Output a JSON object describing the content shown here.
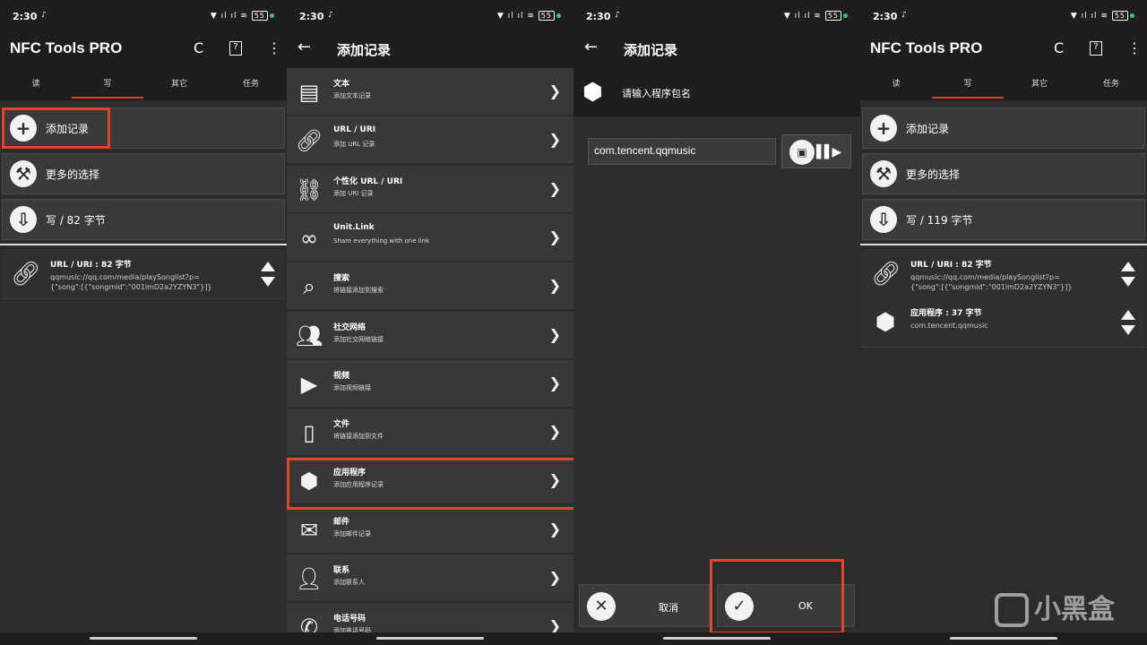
{
  "status": {
    "time": "2:30",
    "battery": "55"
  },
  "app": {
    "title": "NFC Tools PRO",
    "tabs": [
      "读",
      "写",
      "其它",
      "任务"
    ]
  },
  "panel1": {
    "buttons": [
      "添加记录",
      "更多的选择",
      "写 / 82 字节"
    ],
    "record": {
      "title": "URL / URI : 82 字节",
      "desc": "qqmusic://qq.com/media/playSonglist?p={\"song\":[{\"songmid\":\"001lmD2a2YZYN3\"}]}"
    }
  },
  "panel2": {
    "title": "添加记录",
    "items": [
      {
        "title": "文本",
        "desc": "添加文本记录",
        "icon": "document-icon"
      },
      {
        "title": "URL / URI",
        "desc": "添加 URL 记录",
        "icon": "link-icon"
      },
      {
        "title": "个性化 URL / URI",
        "desc": "添加 URI 记录",
        "icon": "custom-link-icon"
      },
      {
        "title": "Unit.Link",
        "desc": "Share everything with one link",
        "icon": "unit-link-icon"
      },
      {
        "title": "搜索",
        "desc": "将链接添加到搜索",
        "icon": "search-icon"
      },
      {
        "title": "社交网络",
        "desc": "添加社交网络链接",
        "icon": "people-icon"
      },
      {
        "title": "视频",
        "desc": "添加视频链接",
        "icon": "video-icon"
      },
      {
        "title": "文件",
        "desc": "将链接添加到文件",
        "icon": "file-icon"
      },
      {
        "title": "应用程序",
        "desc": "添加应用程序记录",
        "icon": "cube-icon"
      },
      {
        "title": "邮件",
        "desc": "添加邮件记录",
        "icon": "mail-icon"
      },
      {
        "title": "联系",
        "desc": "添加联系人",
        "icon": "contact-icon"
      },
      {
        "title": "电话号码",
        "desc": "添加电话号码",
        "icon": "phone-icon"
      }
    ]
  },
  "panel3": {
    "title": "添加记录",
    "prompt": "请输入程序包名",
    "input_value": "com.tencent.qqmusic",
    "cancel": "取消",
    "ok": "OK"
  },
  "panel4": {
    "buttons": [
      "添加记录",
      "更多的选择",
      "写 / 119 字节"
    ],
    "records": [
      {
        "title": "URL / URI : 82 字节",
        "desc": "qqmusic://qq.com/media/playSonglist?p={\"song\":[{\"songmid\":\"001lmD2a2YZYN3\"}]}"
      },
      {
        "title": "应用程序 : 37 字节",
        "desc": "com.tencent.qqmusic"
      }
    ]
  },
  "watermark": "小黑盒",
  "colors": {
    "highlight": "#e2452c",
    "tab_indicator": "#e53935"
  }
}
